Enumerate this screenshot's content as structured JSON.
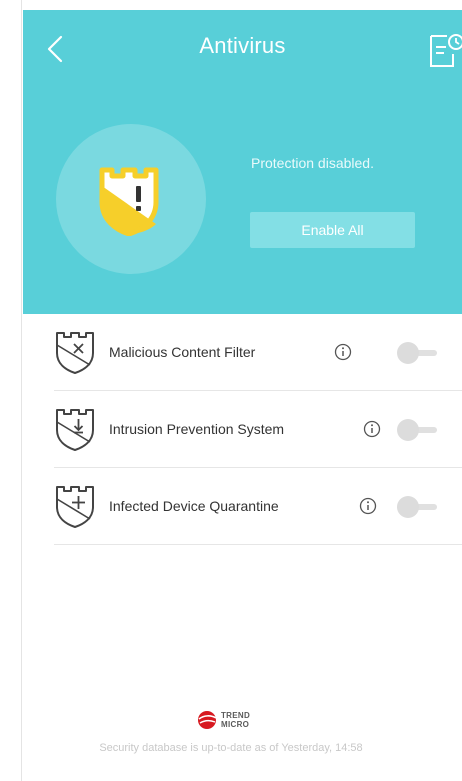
{
  "header": {
    "title": "Antivirus",
    "back_icon": "chevron-left-icon",
    "history_icon": "scan-history-icon"
  },
  "status": {
    "icon": "warning-shield-icon",
    "text": "Protection disabled.",
    "enable_all_label": "Enable All"
  },
  "features": [
    {
      "label": "Malicious Content Filter",
      "icon": "shield-x-icon",
      "enabled": false
    },
    {
      "label": "Intrusion Prevention System",
      "icon": "shield-download-icon",
      "enabled": false
    },
    {
      "label": "Infected Device Quarantine",
      "icon": "shield-plus-icon",
      "enabled": false
    }
  ],
  "footer": {
    "brand_line1": "TREND",
    "brand_line2": "MICRO",
    "database_status": "Security database is up-to-date as of Yesterday, 14:58"
  },
  "colors": {
    "hero": "#58cfd8",
    "shield_yellow": "#f6cf2a",
    "toggle_off": "#dcdcdc",
    "brand_red": "#d71920"
  }
}
